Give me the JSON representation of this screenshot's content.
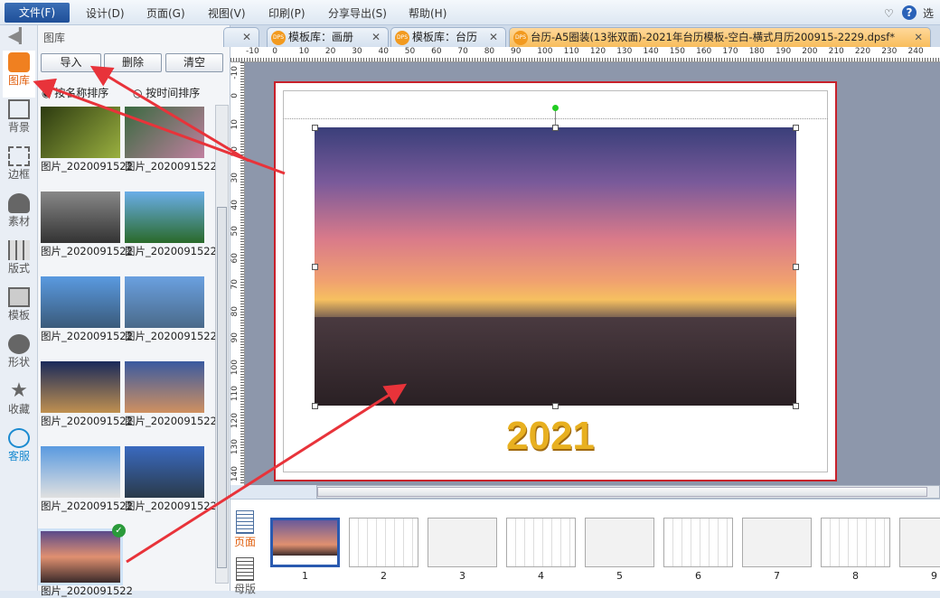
{
  "menu": {
    "file": "文件(F)",
    "design": "设计(D)",
    "page": "页面(G)",
    "view": "视图(V)",
    "print": "印刷(P)",
    "share": "分享导出(S)",
    "help": "帮助(H)",
    "options": "选项"
  },
  "sidebar": [
    {
      "label": "图库"
    },
    {
      "label": "背景"
    },
    {
      "label": "边框"
    },
    {
      "label": "素材"
    },
    {
      "label": "版式"
    },
    {
      "label": "模板"
    },
    {
      "label": "形状"
    },
    {
      "label": "收藏"
    },
    {
      "label": "客服"
    }
  ],
  "panel": {
    "title": "图库",
    "import": "导入",
    "delete": "删除",
    "clear": "清空",
    "sort_name": "按名称排序",
    "sort_time": "按时间排序",
    "images": [
      "图片_2020091522",
      "图片_2020091522",
      "图片_2020091522",
      "图片_2020091522",
      "图片_2020091522",
      "图片_2020091522",
      "图片_2020091522",
      "图片_2020091522",
      "图片_2020091522",
      "图片_2020091522",
      "图片_2020091522"
    ]
  },
  "tabs": [
    {
      "label": "模板库：画册"
    },
    {
      "label": "模板库：台历"
    },
    {
      "label": "台历-A5圈装(13张双面)-2021年台历模板-空白-横式月历200915-2229.dpsf*"
    }
  ],
  "ruler_top": [
    "-10",
    "0",
    "10",
    "20",
    "30",
    "40",
    "50",
    "60",
    "70",
    "80",
    "90",
    "100",
    "110",
    "120",
    "130",
    "140",
    "150",
    "160",
    "170",
    "180",
    "190",
    "200",
    "210",
    "220",
    "230",
    "240"
  ],
  "ruler_left": [
    "-10",
    "0",
    "10",
    "20",
    "30",
    "40",
    "50",
    "60",
    "70",
    "80",
    "90",
    "100",
    "110",
    "120",
    "130",
    "140"
  ],
  "canvas": {
    "year": "2021"
  },
  "pages": {
    "tab_pages": "页面",
    "tab_layout": "母版",
    "numbers": [
      "1",
      "2",
      "3",
      "4",
      "5",
      "6",
      "7",
      "8",
      "9"
    ]
  },
  "colors": {
    "accent": "#1f4f98",
    "arrow": "#e8333a",
    "page_border": "#c8202a"
  }
}
